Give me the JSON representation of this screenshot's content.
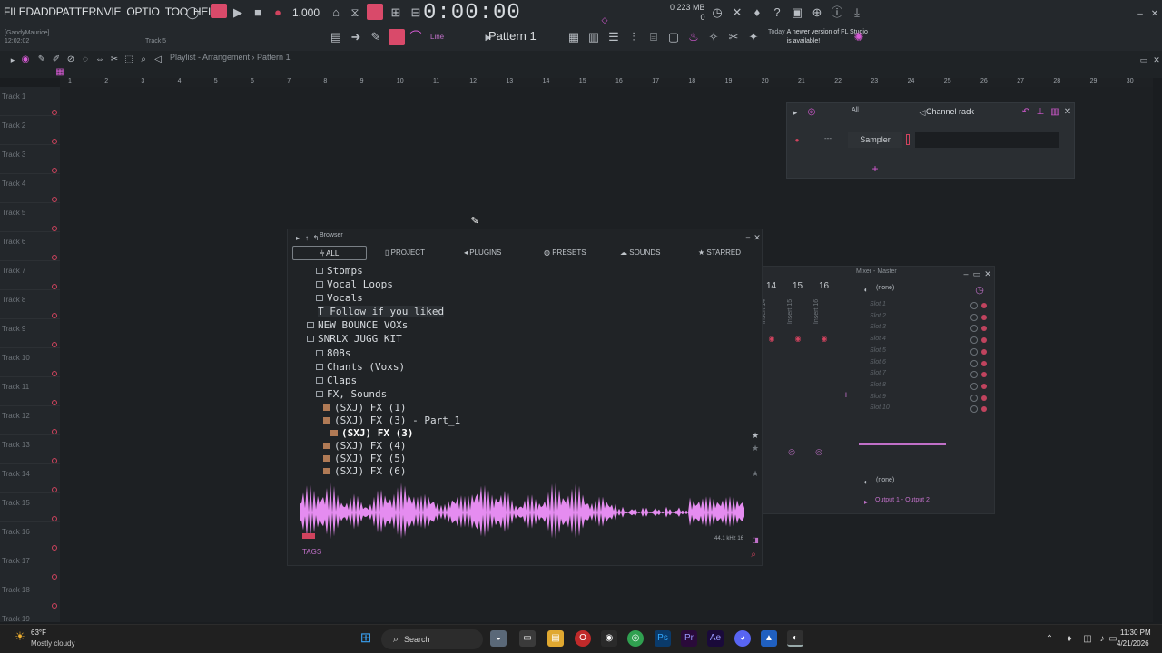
{
  "colors": {
    "accent": "#d85bd6",
    "record_red": "#d0435e",
    "panel": "#24282c"
  },
  "toolbar": {
    "menus": [
      "FILE",
      "D",
      "ADD",
      "PATTERN",
      "VIE",
      "OPTIO",
      "TOO",
      "HEL"
    ],
    "tempo": "1.000",
    "time": "0:00:00",
    "memory_top": "223 MB",
    "memory_cpu": "0",
    "user": "[GandyMaurice]",
    "session_time": "12:02:02",
    "track_label": "Track 5",
    "snap": "Line",
    "pattern": "Pattern 1",
    "news_day": "Today",
    "news_text": "A newer version of FL Studio is available!"
  },
  "playlist": {
    "title": "Playlist - Arrangement",
    "pattern_crumb": "Pattern 1",
    "ruler": [
      "1",
      "2",
      "3",
      "4",
      "5",
      "6",
      "7",
      "8",
      "9",
      "10",
      "11",
      "12",
      "13",
      "14",
      "15",
      "16",
      "17",
      "18",
      "19",
      "20",
      "21",
      "22",
      "23",
      "24",
      "25",
      "26",
      "27",
      "28",
      "29",
      "30"
    ],
    "tracks": [
      "Track 1",
      "Track 2",
      "Track 3",
      "Track 4",
      "Track 5",
      "Track 6",
      "Track 7",
      "Track 8",
      "Track 9",
      "Track 10",
      "Track 11",
      "Track 12",
      "Track 13",
      "Track 14",
      "Track 15",
      "Track 16",
      "Track 17",
      "Track 18",
      "Track 19"
    ]
  },
  "channel_rack": {
    "title": "Channel rack",
    "filter": "All",
    "channel": "Sampler",
    "channel_number": "---"
  },
  "browser": {
    "title": "Browser",
    "tabs": [
      "ALL",
      "PROJECT",
      "PLUGINS",
      "PRESETS",
      "SOUNDS",
      "STARRED"
    ],
    "items": [
      {
        "label": "Stomps",
        "kind": "folder"
      },
      {
        "label": "Vocal Loops",
        "kind": "folder"
      },
      {
        "label": "Vocals",
        "kind": "folder"
      },
      {
        "label": "Follow if you liked",
        "kind": "text"
      },
      {
        "label": "NEW BOUNCE VOXs",
        "kind": "folder"
      },
      {
        "label": "SNRLX JUGG KIT",
        "kind": "folder"
      },
      {
        "label": "808s",
        "kind": "folder"
      },
      {
        "label": "Chants (Voxs)",
        "kind": "folder"
      },
      {
        "label": "Claps",
        "kind": "folder"
      },
      {
        "label": "FX, Sounds",
        "kind": "folder"
      },
      {
        "label": "(SXJ) FX (1)",
        "kind": "file"
      },
      {
        "label": "(SXJ) FX (3) - Part_1",
        "kind": "file"
      },
      {
        "label": "(SXJ) FX (3)",
        "kind": "file"
      },
      {
        "label": "(SXJ) FX (4)",
        "kind": "file"
      },
      {
        "label": "(SXJ) FX (5)",
        "kind": "file"
      },
      {
        "label": "(SXJ) FX (6)",
        "kind": "file"
      }
    ],
    "tags_label": "TAGS",
    "sample_info": "44.1 kHz 16"
  },
  "mixer": {
    "title": "Mixer - Master",
    "channels": [
      "14",
      "15",
      "16"
    ],
    "inserts": [
      "Insert 14",
      "Insert 15",
      "Insert 16"
    ],
    "input": "(none)",
    "slots": [
      "Slot 1",
      "Slot 2",
      "Slot 3",
      "Slot 4",
      "Slot 5",
      "Slot 6",
      "Slot 7",
      "Slot 8",
      "Slot 9",
      "Slot 10"
    ],
    "eq_none": "(none)",
    "output": "Output 1 - Output 2"
  },
  "taskbar": {
    "temp": "63°F",
    "condition": "Mostly cloudy",
    "search": "Search",
    "time": "11:30 PM",
    "date": "4/21/2026"
  }
}
